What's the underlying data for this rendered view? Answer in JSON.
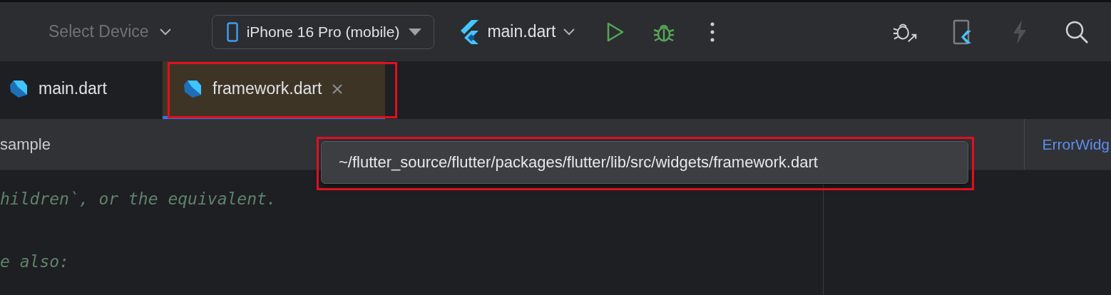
{
  "toolbar": {
    "device_placeholder": "Select Device",
    "device": "iPhone 16 Pro (mobile)",
    "run_config": "main.dart"
  },
  "tabs": [
    {
      "label": "main.dart",
      "selected": false,
      "highlighted": false
    },
    {
      "label": "framework.dart",
      "selected": true,
      "highlighted": true
    }
  ],
  "breadcrumb": {
    "left": "sample",
    "right": "ErrorWidg"
  },
  "tooltip": {
    "text": "~/flutter_source/flutter/packages/flutter/lib/src/widgets/framework.dart",
    "highlighted": true
  },
  "code_lines": [
    "hildren`, or the equivalent.",
    "e also:"
  ]
}
